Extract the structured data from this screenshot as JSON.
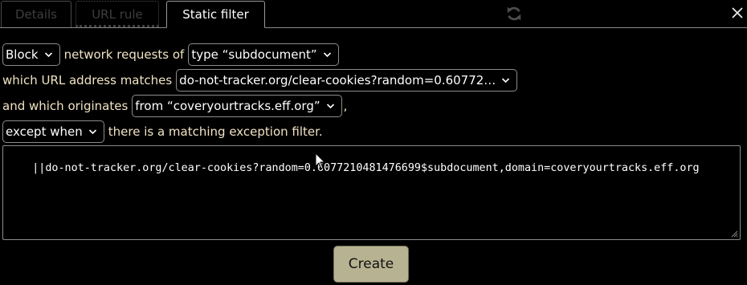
{
  "tabs": [
    {
      "label": "Details",
      "state": "disabled"
    },
    {
      "label": "URL rule",
      "state": "disabled"
    },
    {
      "label": "Static filter",
      "state": "active"
    }
  ],
  "icons": {
    "refresh": "refresh-icon",
    "close": "close-icon",
    "chevron": "chevron-down-icon"
  },
  "form": {
    "action_select": "Block",
    "text_network_requests_of": "network requests of",
    "type_select": "type “subdocument”",
    "text_which_url_matches": "which URL address matches",
    "url_select": "do-not-tracker.org/clear-cookies?random=0.60772…",
    "text_which_originates": "and which originates",
    "origin_select": "from “coveryourtracks.eff.org”",
    "text_comma": ",",
    "exception_select": "except when",
    "text_exception": "there is a matching exception filter."
  },
  "filter_text": "||do-not-tracker.org/clear-cookies?random=0.6077210481476699$subdocument,domain=coveryourtracks.eff.org",
  "create_label": "Create",
  "colors": {
    "background": "#000000",
    "label_text": "#f1e3c4",
    "button_bg": "#b7b291",
    "border": "#8c8c8c"
  }
}
